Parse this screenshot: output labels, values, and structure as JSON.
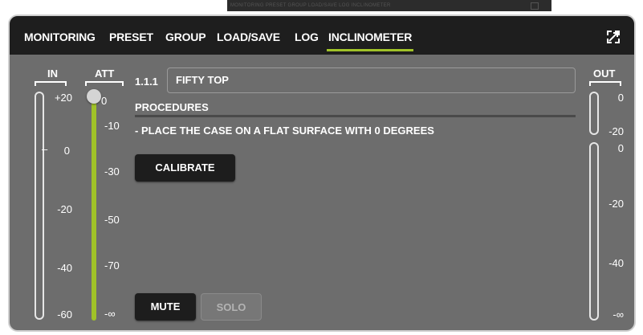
{
  "ghost_tabs": "MONITORING PRESET GROUP LOAD/SAVE LOG INCLINOMETER",
  "tabs": [
    {
      "label": "MONITORING"
    },
    {
      "label": "PRESET"
    },
    {
      "label": "GROUP"
    },
    {
      "label": "LOAD/SAVE"
    },
    {
      "label": "LOG"
    },
    {
      "label": "INCLINOMETER",
      "active": true
    }
  ],
  "icons": {
    "expand": "expand-icon"
  },
  "colors": {
    "accent": "#a0c228",
    "panel": "#6d6d6d",
    "tabbar": "#1e1e1e"
  },
  "in_meter": {
    "label": "IN",
    "ticks": [
      "+20",
      "0",
      "-20",
      "-40",
      "-60"
    ],
    "marker": "–"
  },
  "att_slider": {
    "label": "ATT",
    "ticks": [
      "0",
      "-10",
      "-30",
      "-50",
      "-70",
      "-∞"
    ],
    "level": 1.0
  },
  "out_meter": {
    "label": "OUT",
    "top_ticks": [
      "0",
      "-20"
    ],
    "ticks": [
      "0",
      "-20",
      "-40",
      "-∞"
    ]
  },
  "channel": {
    "id": "1.1.1",
    "name": "FIFTY TOP"
  },
  "procedures": {
    "heading": "PROCEDURES",
    "instruction": "- PLACE THE CASE ON A FLAT SURFACE WITH 0 DEGREES"
  },
  "buttons": {
    "calibrate": "CALIBRATE",
    "mute": "MUTE",
    "solo": "SOLO"
  }
}
